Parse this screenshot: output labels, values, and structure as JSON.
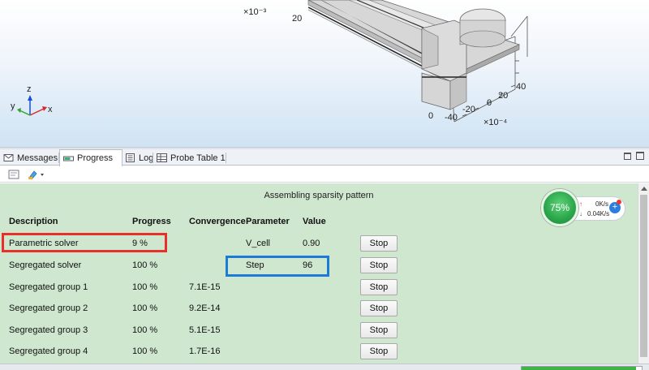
{
  "graphics": {
    "exponent_top": "×10⁻³",
    "tick_20": "20",
    "y_ticks": [
      "40",
      "20",
      "0",
      "-20",
      "-40"
    ],
    "x_ticks": [
      "0",
      "-40",
      "-20",
      "0",
      "20",
      "40"
    ],
    "exponent_bottom": "×10⁻⁴",
    "axes": {
      "y": "y",
      "z": "z",
      "x": "x"
    }
  },
  "tabs": [
    {
      "label": "Messages",
      "icon": "messages-icon"
    },
    {
      "label": "Progress",
      "icon": "progress-icon",
      "active": true
    },
    {
      "label": "Log",
      "icon": "log-icon"
    },
    {
      "label": "Probe Table 1",
      "icon": "table-icon"
    }
  ],
  "toolbar": {
    "icons": [
      "clear-icon",
      "color-dropdown-icon"
    ]
  },
  "progress": {
    "status": "Assembling sparsity pattern",
    "headers": {
      "description": "Description",
      "progress": "Progress",
      "convergence": "Convergence",
      "parameter": "Parameter",
      "value": "Value"
    },
    "rows": [
      {
        "description": "Parametric solver",
        "progress": "9 %",
        "convergence": "",
        "parameter": "V_cell",
        "value": "0.90",
        "stop": "Stop"
      },
      {
        "description": "Segregated solver",
        "progress": "100 %",
        "convergence": "",
        "parameter": "Step",
        "value": "96",
        "stop": "Stop"
      },
      {
        "description": "Segregated group 1",
        "progress": "100 %",
        "convergence": "7.1E-15",
        "parameter": "",
        "value": "",
        "stop": "Stop"
      },
      {
        "description": "Segregated group 2",
        "progress": "100 %",
        "convergence": "9.2E-14",
        "parameter": "",
        "value": "",
        "stop": "Stop"
      },
      {
        "description": "Segregated group 3",
        "progress": "100 %",
        "convergence": "5.1E-15",
        "parameter": "",
        "value": "",
        "stop": "Stop"
      },
      {
        "description": "Segregated group 4",
        "progress": "100 %",
        "convergence": "1.7E-16",
        "parameter": "",
        "value": "",
        "stop": "Stop"
      }
    ]
  },
  "speed_widget": {
    "cpu": "75%",
    "up": "0K/s",
    "down": "0.04K/s",
    "plus": "+"
  },
  "statusbar": {
    "progress_fraction": 0.95
  },
  "colors": {
    "highlight_red": "#e8302a",
    "highlight_blue": "#1d7bd8",
    "panel_green": "#cfe7cf"
  }
}
